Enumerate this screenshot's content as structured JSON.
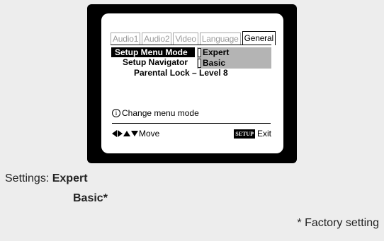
{
  "tabs": [
    "Audio1",
    "Audio2",
    "Video",
    "Language",
    "General"
  ],
  "active_tab_index": 4,
  "menu": {
    "rows": [
      "Setup Menu Mode",
      "Setup Navigator",
      "Parental Lock – Level 8"
    ],
    "options": [
      "Expert",
      "Basic"
    ]
  },
  "help": {
    "icon": "i",
    "text": "Change menu mode"
  },
  "nav": {
    "move_label": "Move",
    "setup_key": "SETUP",
    "exit_label": "Exit"
  },
  "settings": {
    "label": "Settings:",
    "value1": "Expert",
    "value2": "Basic*"
  },
  "footnote": "* Factory setting"
}
